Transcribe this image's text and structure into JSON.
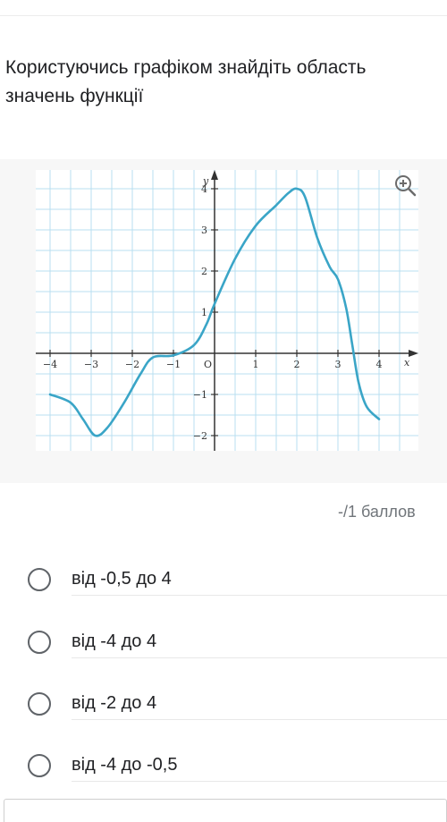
{
  "question": {
    "text": "Користуючись графіком знайдіть область значень функції"
  },
  "graph": {
    "x_label": "x",
    "y_label": "y",
    "origin_label": "O",
    "x_ticks": [
      {
        "value": -4,
        "label": "−4"
      },
      {
        "value": -3,
        "label": "−3"
      },
      {
        "value": -2,
        "label": "−2"
      },
      {
        "value": -1,
        "label": "−1"
      },
      {
        "value": 1,
        "label": "1"
      },
      {
        "value": 2,
        "label": "2"
      },
      {
        "value": 3,
        "label": "3"
      },
      {
        "value": 4,
        "label": "4"
      }
    ],
    "y_ticks": [
      {
        "value": 4,
        "label": "4"
      },
      {
        "value": 3,
        "label": "3"
      },
      {
        "value": 2,
        "label": "2"
      },
      {
        "value": 1,
        "label": "1"
      },
      {
        "value": -1,
        "label": "−1"
      },
      {
        "value": -2,
        "label": "−2"
      }
    ],
    "curve_points": [
      [
        -4,
        -1
      ],
      [
        -3.5,
        -1.2
      ],
      [
        -3.2,
        -1.6
      ],
      [
        -2.9,
        -2
      ],
      [
        -2.6,
        -1.8
      ],
      [
        -2.2,
        -1.2
      ],
      [
        -1.8,
        -0.5
      ],
      [
        -1.5,
        -0.1
      ],
      [
        -1,
        -0.05
      ],
      [
        -0.5,
        0.2
      ],
      [
        -0.2,
        0.7
      ],
      [
        0,
        1.2
      ],
      [
        0.5,
        2.3
      ],
      [
        1,
        3.1
      ],
      [
        1.5,
        3.6
      ],
      [
        1.8,
        3.9
      ],
      [
        2,
        4
      ],
      [
        2.2,
        3.8
      ],
      [
        2.5,
        2.8
      ],
      [
        2.8,
        2.1
      ],
      [
        3,
        1.8
      ],
      [
        3.2,
        1.1
      ],
      [
        3.35,
        0.2
      ],
      [
        3.5,
        -0.7
      ],
      [
        3.7,
        -1.3
      ],
      [
        4,
        -1.6
      ]
    ],
    "curve_color": "#3aa5c7",
    "grid_color": "#b9dff0",
    "zoom_icon": "zoom-in-icon"
  },
  "points": {
    "text": "-/1 баллов"
  },
  "options": [
    {
      "label": "від -0,5 до 4"
    },
    {
      "label": "від -4 до 4"
    },
    {
      "label": "від -2 до 4"
    },
    {
      "label": "від -4 до -0,5"
    }
  ]
}
